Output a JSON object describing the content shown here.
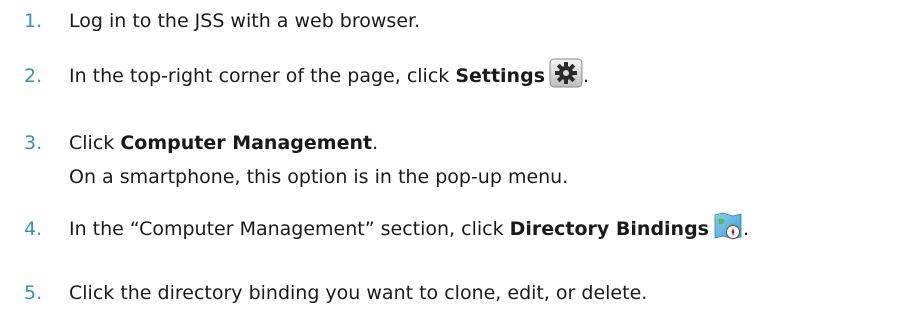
{
  "steps": [
    {
      "number": "1.",
      "text": "Log in to the JSS with a web browser."
    },
    {
      "number": "2.",
      "text_before": "In the top-right corner of the page, click ",
      "bold": "Settings",
      "text_after": ".",
      "icon": "gear-icon"
    },
    {
      "number": "3.",
      "text_before": "Click ",
      "bold": "Computer Management",
      "text_after": ".",
      "note": "On a smartphone, this option is in the pop-up menu."
    },
    {
      "number": "4.",
      "text_before": "In the “Computer Management” section, click ",
      "bold": "Directory Bindings",
      "text_after": ".",
      "icon": "directory-bindings-icon"
    },
    {
      "number": "5.",
      "text": "Click the directory binding you want to clone, edit, or delete."
    }
  ],
  "colors": {
    "number": "#3a8fb7",
    "text": "#1a1a1a"
  }
}
